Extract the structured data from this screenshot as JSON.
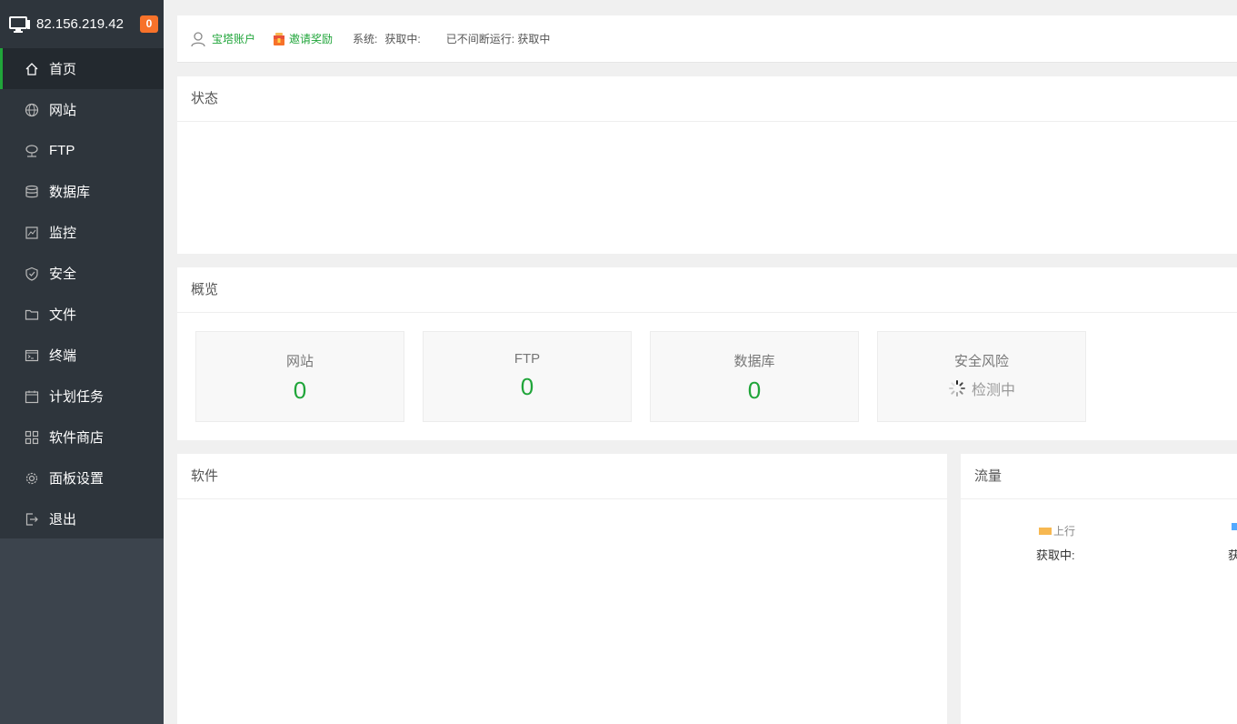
{
  "sidebar": {
    "ip": "82.156.219.42",
    "badge": "0",
    "items": [
      {
        "label": "首页",
        "icon": "home-icon",
        "active": true
      },
      {
        "label": "网站",
        "icon": "globe-icon"
      },
      {
        "label": "FTP",
        "icon": "ftp-icon"
      },
      {
        "label": "数据库",
        "icon": "database-icon"
      },
      {
        "label": "监控",
        "icon": "monitor-chart-icon"
      },
      {
        "label": "安全",
        "icon": "shield-icon"
      },
      {
        "label": "文件",
        "icon": "folder-icon"
      },
      {
        "label": "终端",
        "icon": "terminal-icon"
      },
      {
        "label": "计划任务",
        "icon": "calendar-icon"
      },
      {
        "label": "软件商店",
        "icon": "apps-grid-icon"
      },
      {
        "label": "面板设置",
        "icon": "gear-icon"
      },
      {
        "label": "退出",
        "icon": "logout-icon"
      }
    ]
  },
  "topbar": {
    "account": "宝塔账户",
    "invite": "邀请奖励",
    "system_label": "系统:",
    "system_value": "获取中:",
    "uptime": "已不间断运行: 获取中"
  },
  "panels": {
    "status": "状态",
    "overview": "概览",
    "software": "软件",
    "traffic": "流量"
  },
  "overview_cards": {
    "site": {
      "title": "网站",
      "value": "0"
    },
    "ftp": {
      "title": "FTP",
      "value": "0"
    },
    "db": {
      "title": "数据库",
      "value": "0"
    },
    "risk": {
      "title": "安全风险",
      "value": "检测中"
    }
  },
  "traffic": {
    "up_label": "上行",
    "up_value": "获取中:",
    "down_value": "获"
  },
  "colors": {
    "accent": "#20a53a",
    "badge": "#f7722a",
    "sidebar": "#3c444d",
    "up": "#f7b851",
    "down": "#52a9ff"
  }
}
